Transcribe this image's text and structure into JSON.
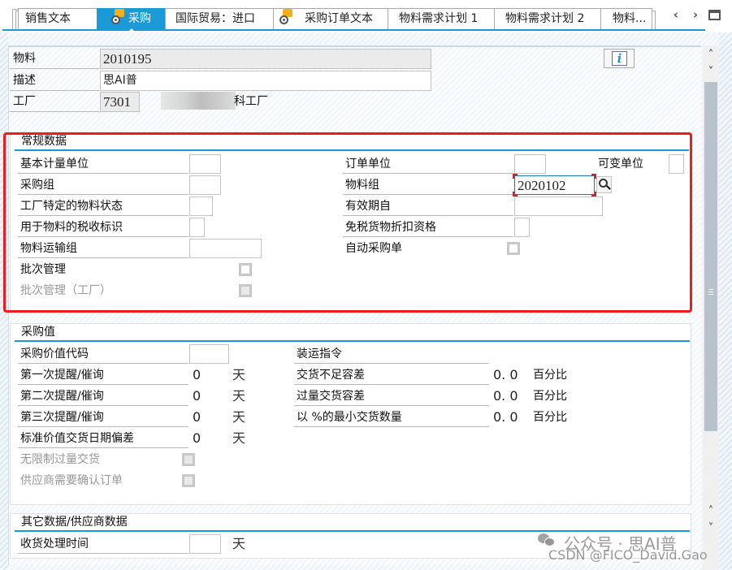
{
  "tabs": [
    {
      "label": "销售文本",
      "active": false
    },
    {
      "label": "采购",
      "active": true,
      "icon": "purchasing-icon"
    },
    {
      "label": "国际贸易：进口",
      "active": false
    },
    {
      "label": "采购订单文本",
      "active": false,
      "icon": "purchasing-icon"
    },
    {
      "label": "物料需求计划 1",
      "active": false
    },
    {
      "label": "物料需求计划 2",
      "active": false
    },
    {
      "label": "物料...",
      "active": false
    }
  ],
  "tab_nav": {
    "prev": "‹",
    "next": "›",
    "list_icon": "tab-list-icon"
  },
  "header": {
    "material_label": "物料",
    "material_value": "2010195",
    "description_label": "描述",
    "description_value": "思AI普",
    "plant_label": "工厂",
    "plant_value": "7301",
    "plant_name_suffix": "科工厂",
    "info_button": "i"
  },
  "general_data": {
    "title": "常规数据",
    "left": [
      {
        "label": "基本计量单位",
        "value": ""
      },
      {
        "label": "采购组",
        "value": ""
      },
      {
        "label": "工厂特定的物料状态",
        "value": ""
      },
      {
        "label": "用于物料的税收标识",
        "value": ""
      },
      {
        "label": "物料运输组",
        "value": ""
      }
    ],
    "batch_management_label": "批次管理",
    "batch_management_checked": false,
    "batch_management_plant_label": "批次管理（工厂）",
    "batch_management_plant_checked": false,
    "right": {
      "order_unit_label": "订单单位",
      "order_unit_value": "",
      "variable_unit_label": "可变单位",
      "variable_unit_value": "",
      "material_group_label": "物料组",
      "material_group_value": "2020102",
      "valid_from_label": "有效期自",
      "valid_from_value": "",
      "tax_free_discount_label": "免税货物折扣资格",
      "tax_free_discount_value": "",
      "auto_po_label": "自动采购单",
      "auto_po_checked": false
    }
  },
  "purchasing_values": {
    "title": "采购值",
    "value_code_label": "采购价值代码",
    "value_code_value": "",
    "reminders": [
      {
        "label": "第一次提醒/催询",
        "value": "0",
        "unit": "天"
      },
      {
        "label": "第二次提醒/催询",
        "value": "0",
        "unit": "天"
      },
      {
        "label": "第三次提醒/催询",
        "value": "0",
        "unit": "天"
      },
      {
        "label": "标准价值交货日期偏差",
        "value": "0",
        "unit": "天"
      }
    ],
    "unlimited_overdelivery_label": "无限制过量交货",
    "vendor_ack_label": "供应商需要确认订单",
    "shipping_instructions_label": "装运指令",
    "tolerances": [
      {
        "label": "交货不足容差",
        "value": "0. 0",
        "unit": "百分比"
      },
      {
        "label": "过量交货容差",
        "value": "0. 0",
        "unit": "百分比"
      },
      {
        "label": "以 %的最小交货数量",
        "value": "0. 0",
        "unit": "百分比"
      }
    ]
  },
  "other_data": {
    "title": "其它数据/供应商数据",
    "gr_processing_time_label": "收货处理时间",
    "gr_processing_time_value": "",
    "gr_processing_time_unit": "天"
  },
  "watermark": {
    "line1": "公众号 · 思AI普",
    "line2": "CSDN @FICO_David.Gao"
  },
  "colors": {
    "accent": "#1a9ad6",
    "highlight_box": "#ee1c1c",
    "tab_icon_gold": "#f2b01e"
  }
}
